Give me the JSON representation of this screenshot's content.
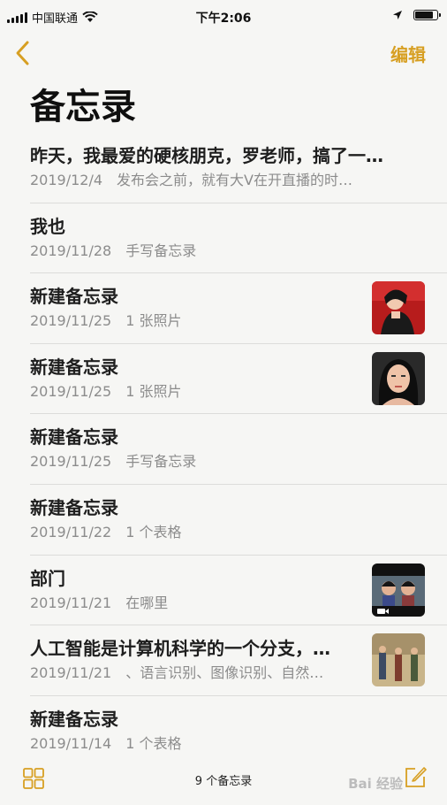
{
  "status": {
    "carrier": "中国联通",
    "time": "下午2:06"
  },
  "nav": {
    "edit_label": "编辑"
  },
  "title": "备忘录",
  "notes": [
    {
      "title": "昨天，我最爱的硬核朋克，罗老师，搞了一…",
      "date": "2019/12/4",
      "preview": "发布会之前，就有大V在开直播的时…"
    },
    {
      "title": "我也",
      "date": "2019/11/28",
      "preview": "手写备忘录"
    },
    {
      "title": "新建备忘录",
      "date": "2019/11/25",
      "preview": "1 张照片"
    },
    {
      "title": "新建备忘录",
      "date": "2019/11/25",
      "preview": "1 张照片"
    },
    {
      "title": "新建备忘录",
      "date": "2019/11/25",
      "preview": "手写备忘录"
    },
    {
      "title": "新建备忘录",
      "date": "2019/11/22",
      "preview": "1 个表格"
    },
    {
      "title": "部门",
      "date": "2019/11/21",
      "preview": "在哪里"
    },
    {
      "title": "人工智能是计算机科学的一个分支，…",
      "date": "2019/11/21",
      "preview": "、语言识别、图像识别、自然…"
    },
    {
      "title": "新建备忘录",
      "date": "2019/11/14",
      "preview": "1 个表格"
    }
  ],
  "footer": {
    "count": "9 个备忘录",
    "watermark": "Bai 经验"
  },
  "colors": {
    "accent": "#d79f22",
    "background": "#f6f6f4",
    "separator": "#dcdcda"
  }
}
